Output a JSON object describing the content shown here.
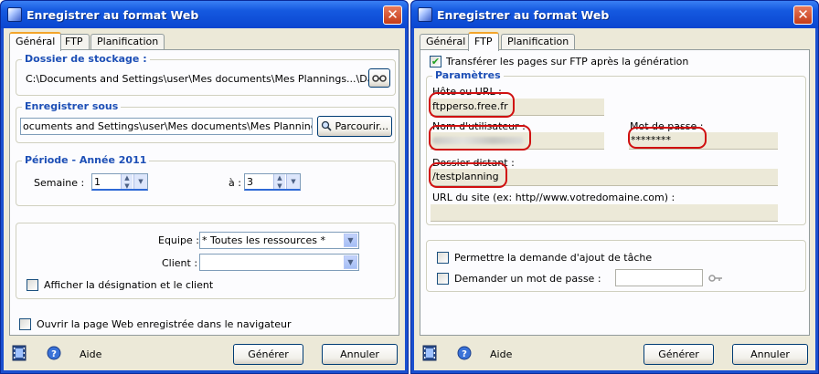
{
  "left_window": {
    "title": "Enregistrer au format Web",
    "tabs": [
      {
        "label": "Général",
        "active": true
      },
      {
        "label": "FTP"
      },
      {
        "label": "Planification"
      }
    ],
    "storage": {
      "title": "Dossier de stockage :",
      "path": "C:\\Documents and Settings\\user\\Mes documents\\Mes Plannings...\\Datas"
    },
    "save_as": {
      "title": "Enregistrer sous",
      "value": "ocuments and Settings\\user\\Mes documents\\Mes Plannings\\html",
      "browse_label": "Parcourir..."
    },
    "period": {
      "title": "Période - Année 2011",
      "week_label": "Semaine :",
      "week_from": "1",
      "to_label": "à :",
      "week_to": "3"
    },
    "filters": {
      "team_label": "Equipe :",
      "team_value": "* Toutes les ressources *",
      "client_label": "Client :",
      "client_value": "",
      "show_designation_label": "Afficher la désignation et le client",
      "show_designation_checked": false
    },
    "open_browser_label": "Ouvrir la page Web enregistrée dans le navigateur",
    "open_browser_checked": false,
    "help_label": "Aide",
    "generate_label": "Générer",
    "cancel_label": "Annuler"
  },
  "right_window": {
    "title": "Enregistrer au format Web",
    "tabs": [
      {
        "label": "Général"
      },
      {
        "label": "FTP",
        "active": true
      },
      {
        "label": "Planification"
      }
    ],
    "transfer_label": "Transférer les pages sur FTP après la génération",
    "transfer_checked": true,
    "params": {
      "title": "Paramètres",
      "host_label": "Hôte ou URL :",
      "host_value": "ftpperso.free.fr",
      "user_label": "Nom d'utilisateur :",
      "password_label": "Mot de passe :",
      "password_value": "********",
      "remote_folder_label": "Dossier distant :",
      "remote_folder_value": "/testplanning",
      "site_url_label": "URL du site (ex: http//www.votredomaine.com) :",
      "site_url_value": ""
    },
    "allow_task_label": "Permettre la demande d'ajout de tâche",
    "allow_task_checked": false,
    "ask_password_label": "Demander un mot de passe :",
    "ask_password_checked": false,
    "ask_password_value": "",
    "help_label": "Aide",
    "generate_label": "Générer",
    "cancel_label": "Annuler"
  },
  "colors": {
    "title_bar": "#0a46d0",
    "group_title": "#1d4fb6",
    "dialog_bg": "#ece9d8",
    "highlight_ring": "#d01010",
    "active_tab": "#f3a52b"
  },
  "icons": [
    "window-icon",
    "close-icon",
    "ftp-test-icon",
    "search-icon",
    "film-icon",
    "help-icon",
    "key-icon",
    "spin-up-icon",
    "spin-down-icon",
    "dropdown-arrow-icon"
  ]
}
